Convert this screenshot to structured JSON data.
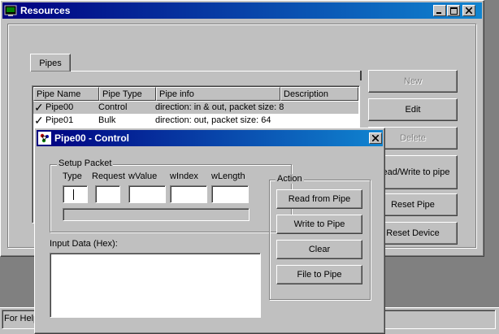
{
  "resources_window": {
    "title": "Resources",
    "tab_label": "Pipes",
    "columns": [
      "Pipe Name",
      "Pipe Type",
      "Pipe info",
      "Description"
    ],
    "rows": [
      {
        "check": "✓",
        "name": "Pipe00",
        "type": "Control",
        "info": "direction: in & out, packet size: 8",
        "description": ""
      },
      {
        "check": "✓",
        "name": "Pipe01",
        "type": "Bulk",
        "info": "direction: out, packet size: 64",
        "description": ""
      }
    ],
    "buttons": {
      "new": "New",
      "edit": "Edit",
      "delete": "Delete",
      "read_write": "Read/Write to pipe",
      "reset_pipe": "Reset Pipe",
      "reset_device": "Reset Device"
    }
  },
  "status_bar": {
    "text": "For Help"
  },
  "dialog": {
    "title": "Pipe00 - Control",
    "setup_packet": {
      "label": "Setup Packet",
      "fields": [
        {
          "label": "Type",
          "value": ""
        },
        {
          "label": "Request",
          "value": ""
        },
        {
          "label": "wValue",
          "value": ""
        },
        {
          "label": "wIndex",
          "value": ""
        },
        {
          "label": "wLength",
          "value": ""
        }
      ]
    },
    "input_data_label": "Input Data (Hex):",
    "action": {
      "label": "Action",
      "buttons": [
        "Read from Pipe",
        "Write to Pipe",
        "Clear",
        "File to Pipe"
      ]
    }
  },
  "colors": {
    "face": "#c0c0c0",
    "title_active": "#000080",
    "title_active_end": "#1084d0",
    "desktop": "#808080"
  },
  "icons": [
    "app-icon",
    "minimize-icon",
    "maximize-icon",
    "close-icon",
    "check-icon",
    "dialog-icon"
  ]
}
